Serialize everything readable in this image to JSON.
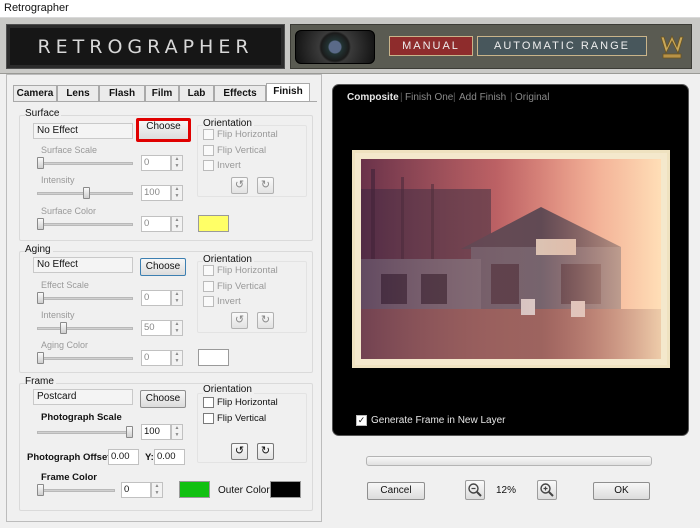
{
  "window": {
    "title": "Retrographer"
  },
  "header": {
    "logo_text": "RETROGRAPHER",
    "mode_manual": "MANUAL",
    "mode_automatic": "AUTOMATIC RANGE"
  },
  "tabs": [
    "Camera",
    "Lens",
    "Flash",
    "Film",
    "Lab",
    "Effects",
    "Finish"
  ],
  "active_tab": "Finish",
  "surface": {
    "title": "Surface",
    "effect": "No Effect",
    "choose_label": "Choose",
    "scale_label": "Surface Scale",
    "scale_value": "0",
    "intensity_label": "Intensity",
    "intensity_value": "100",
    "color_label": "Surface Color",
    "color_value": "0",
    "swatch_color": "#ffff66",
    "orientation_title": "Orientation",
    "flip_h": "Flip Horizontal",
    "flip_v": "Flip Vertical",
    "invert": "Invert"
  },
  "aging": {
    "title": "Aging",
    "effect": "No Effect",
    "choose_label": "Choose",
    "scale_label": "Effect Scale",
    "scale_value": "0",
    "intensity_label": "Intensity",
    "intensity_value": "50",
    "color_label": "Aging Color",
    "color_value": "0",
    "swatch_color": "#ffffff",
    "orientation_title": "Orientation",
    "flip_h": "Flip Horizontal",
    "flip_v": "Flip Vertical",
    "invert": "Invert"
  },
  "frame": {
    "title": "Frame",
    "effect": "Postcard",
    "choose_label": "Choose",
    "scale_label": "Photograph Scale",
    "scale_value": "100",
    "offset_label": "Photograph Offset X:",
    "offset_x": "0.00",
    "offset_y_label": "Y:",
    "offset_y": "0.00",
    "color_label": "Frame Color",
    "color_value": "0",
    "swatch_color": "#11c011",
    "outer_color_label": "Outer Color:",
    "outer_swatch_color": "#000000",
    "orientation_title": "Orientation",
    "flip_h": "Flip Horizontal",
    "flip_v": "Flip Vertical"
  },
  "preview": {
    "tabs": [
      "Composite",
      "Finish One",
      "Add Finish",
      "Original"
    ],
    "active": "Composite",
    "generate_label": "Generate Frame in New Layer",
    "generate_checked": true
  },
  "footer": {
    "cancel_label": "Cancel",
    "zoom": "12%",
    "ok_label": "OK"
  }
}
